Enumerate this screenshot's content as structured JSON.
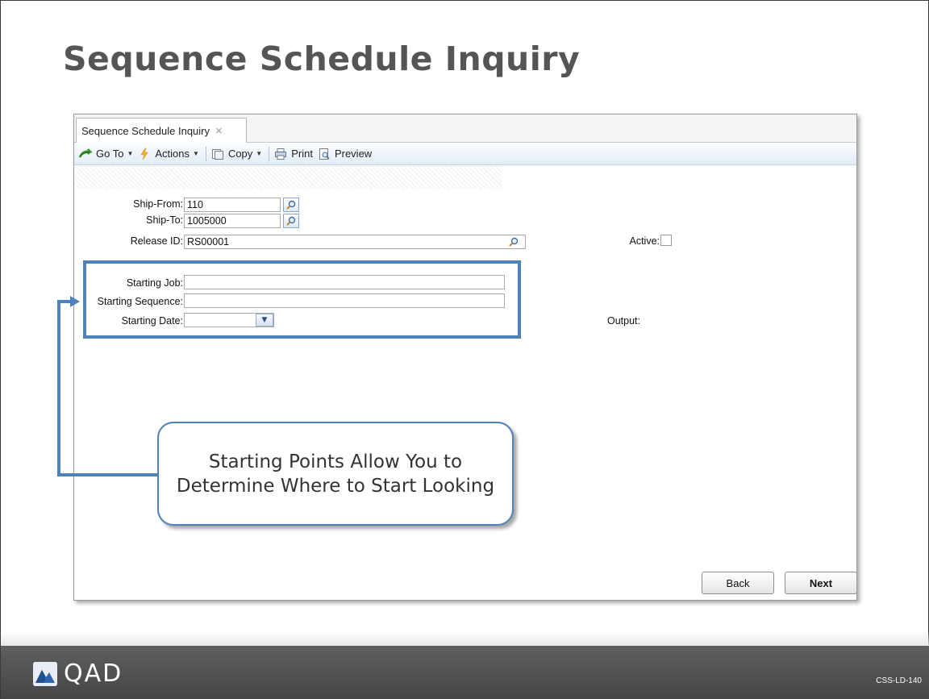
{
  "slide": {
    "title": "Sequence Schedule Inquiry",
    "footer_code": "CSS-LD-140"
  },
  "logo": {
    "text": "QAD"
  },
  "app": {
    "tab_label": "Sequence Schedule Inquiry",
    "tab_close": "×",
    "toolbar": {
      "goto_label": "Go To",
      "actions_label": "Actions",
      "copy_label": "Copy",
      "print_label": "Print",
      "preview_label": "Preview",
      "caret": "▼"
    },
    "form": {
      "ship_from_label": "Ship-From:",
      "ship_from_value": "110",
      "ship_to_label": "Ship-To:",
      "ship_to_value": "1005000",
      "release_id_label": "Release ID:",
      "release_id_value": "RS00001",
      "active_label": "Active:",
      "starting_job_label": "Starting Job:",
      "starting_job_value": "",
      "starting_sequence_label": "Starting Sequence:",
      "starting_sequence_value": "",
      "starting_date_label": "Starting Date:",
      "starting_date_value": "",
      "dropdown_caret": "▼",
      "output_label": "Output:"
    },
    "buttons": {
      "back_label": "Back",
      "next_label": "Next"
    }
  },
  "callout": {
    "text": "Starting Points Allow You to Determine Where to Start Looking"
  },
  "colors": {
    "accent_blue": "#4f81bd",
    "title_gray": "#555555",
    "footer_gray": "#4f4f4f"
  },
  "icons": [
    "go-to-icon",
    "actions-icon",
    "copy-icon",
    "print-icon",
    "preview-icon",
    "lookup-icon",
    "close-icon",
    "chevron-down-icon",
    "qad-logo-icon"
  ]
}
